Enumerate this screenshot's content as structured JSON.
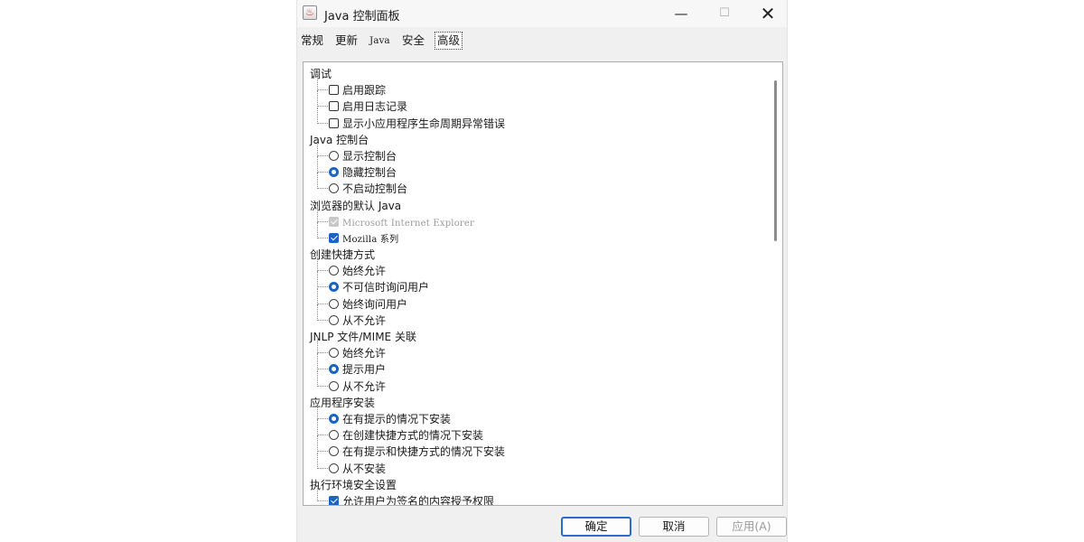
{
  "window": {
    "title": "Java 控制面板",
    "min_glyph": "—",
    "max_glyph": "☐",
    "close_glyph": "✕",
    "icon_glyph": "♨"
  },
  "tabs": [
    {
      "label": "常规"
    },
    {
      "label": "更新"
    },
    {
      "label": "Java"
    },
    {
      "label": "安全"
    },
    {
      "label": "高级",
      "active": true
    }
  ],
  "tree": [
    {
      "type": "category",
      "label": "调试"
    },
    {
      "type": "checkbox",
      "label": "启用跟踪",
      "checked": false
    },
    {
      "type": "checkbox",
      "label": "启用日志记录",
      "checked": false
    },
    {
      "type": "checkbox",
      "label": "显示小应用程序生命周期异常错误",
      "checked": false
    },
    {
      "type": "category",
      "label": "Java 控制台"
    },
    {
      "type": "radio",
      "label": "显示控制台",
      "selected": false
    },
    {
      "type": "radio",
      "label": "隐藏控制台",
      "selected": true
    },
    {
      "type": "radio",
      "label": "不启动控制台",
      "selected": false
    },
    {
      "type": "category",
      "label": "浏览器的默认 Java"
    },
    {
      "type": "checkbox",
      "label": "Microsoft Internet Explorer",
      "checked": true,
      "disabled": true
    },
    {
      "type": "checkbox",
      "label": "Mozilla 系列",
      "checked": true
    },
    {
      "type": "category",
      "label": "创建快捷方式"
    },
    {
      "type": "radio",
      "label": "始终允许",
      "selected": false
    },
    {
      "type": "radio",
      "label": "不可信时询问用户",
      "selected": true
    },
    {
      "type": "radio",
      "label": "始终询问用户",
      "selected": false
    },
    {
      "type": "radio",
      "label": "从不允许",
      "selected": false
    },
    {
      "type": "category",
      "label": "JNLP 文件/MIME 关联"
    },
    {
      "type": "radio",
      "label": "始终允许",
      "selected": false
    },
    {
      "type": "radio",
      "label": "提示用户",
      "selected": true
    },
    {
      "type": "radio",
      "label": "从不允许",
      "selected": false
    },
    {
      "type": "category",
      "label": "应用程序安装"
    },
    {
      "type": "radio",
      "label": "在有提示的情况下安装",
      "selected": true
    },
    {
      "type": "radio",
      "label": "在创建快捷方式的情况下安装",
      "selected": false
    },
    {
      "type": "radio",
      "label": "在有提示和快捷方式的情况下安装",
      "selected": false
    },
    {
      "type": "radio",
      "label": "从不安装",
      "selected": false
    },
    {
      "type": "category",
      "label": "执行环境安全设置"
    },
    {
      "type": "checkbox",
      "label": "允许用户为签名的内容授予权限",
      "checked": true
    }
  ],
  "buttons": {
    "ok": "确定",
    "cancel": "取消",
    "apply": "应用(A)"
  },
  "colors": {
    "accent": "#1a63c6",
    "disabled": "#9a9a9a"
  }
}
